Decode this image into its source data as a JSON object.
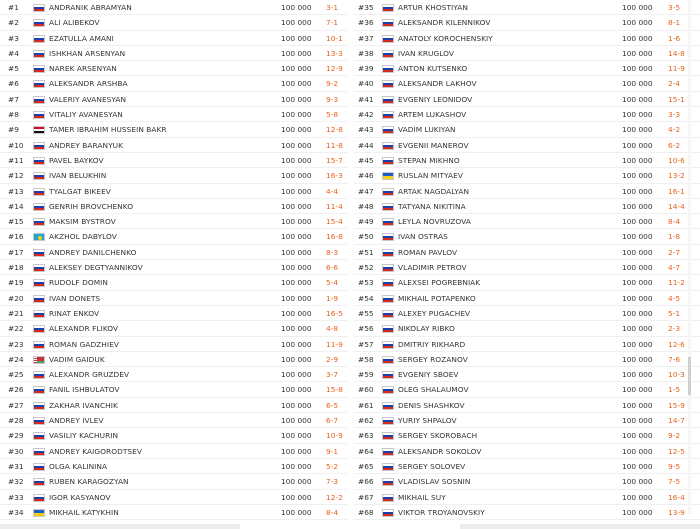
{
  "left_column": [
    {
      "rank": "#1",
      "flag": "ru",
      "name": "Andranik Abramyan",
      "rating": "100 000",
      "score": "3-1"
    },
    {
      "rank": "#2",
      "flag": "ru",
      "name": "Ali Alibekov",
      "rating": "100 000",
      "score": "7-1"
    },
    {
      "rank": "#3",
      "flag": "ru",
      "name": "Ezatulla Amani",
      "rating": "100 000",
      "score": "10-1"
    },
    {
      "rank": "#4",
      "flag": "ru",
      "name": "Ishkhan Arsenyan",
      "rating": "100 000",
      "score": "13-3"
    },
    {
      "rank": "#5",
      "flag": "ru",
      "name": "Narek Arsenyan",
      "rating": "100 000",
      "score": "12-9"
    },
    {
      "rank": "#6",
      "flag": "ru",
      "name": "Aleksandr Arshba",
      "rating": "100 000",
      "score": "9-2"
    },
    {
      "rank": "#7",
      "flag": "ru",
      "name": "Valeriy Avanesyan",
      "rating": "100 000",
      "score": "9-3"
    },
    {
      "rank": "#8",
      "flag": "ru",
      "name": "Vitaliy Avanesyan",
      "rating": "100 000",
      "score": "5-8"
    },
    {
      "rank": "#9",
      "flag": "eg",
      "name": "Tamer Ibrahim Hussein Bakr",
      "rating": "100 000",
      "score": "12-8"
    },
    {
      "rank": "#10",
      "flag": "ru",
      "name": "Andrey Baranyuk",
      "rating": "100 000",
      "score": "11-8"
    },
    {
      "rank": "#11",
      "flag": "ru",
      "name": "Pavel Baykov",
      "rating": "100 000",
      "score": "15-7"
    },
    {
      "rank": "#12",
      "flag": "ru",
      "name": "Ivan Belukhin",
      "rating": "100 000",
      "score": "16-3"
    },
    {
      "rank": "#13",
      "flag": "ru",
      "name": "Tyalgat Bikeev",
      "rating": "100 000",
      "score": "4-4"
    },
    {
      "rank": "#14",
      "flag": "ru",
      "name": "Genrih Brovchenko",
      "rating": "100 000",
      "score": "11-4"
    },
    {
      "rank": "#15",
      "flag": "ru",
      "name": "Maksim Bystrov",
      "rating": "100 000",
      "score": "15-4"
    },
    {
      "rank": "#16",
      "flag": "kz",
      "name": "Akzhol Dabylov",
      "rating": "100 000",
      "score": "16-8"
    },
    {
      "rank": "#17",
      "flag": "ru",
      "name": "Andrey Danilchenko",
      "rating": "100 000",
      "score": "8-3"
    },
    {
      "rank": "#18",
      "flag": "ru",
      "name": "Aleksey Degtyannikov",
      "rating": "100 000",
      "score": "6-6"
    },
    {
      "rank": "#19",
      "flag": "ru",
      "name": "Rudolf Domin",
      "rating": "100 000",
      "score": "5-4"
    },
    {
      "rank": "#20",
      "flag": "ru",
      "name": "Ivan Donets",
      "rating": "100 000",
      "score": "1-9"
    },
    {
      "rank": "#21",
      "flag": "ru",
      "name": "Rinat Enkov",
      "rating": "100 000",
      "score": "16-5"
    },
    {
      "rank": "#22",
      "flag": "ru",
      "name": "Alexandr Flikov",
      "rating": "100 000",
      "score": "4-8"
    },
    {
      "rank": "#23",
      "flag": "ru",
      "name": "Roman Gadzhiev",
      "rating": "100 000",
      "score": "11-9"
    },
    {
      "rank": "#24",
      "flag": "by",
      "name": "Vadim Gaiduk",
      "rating": "100 000",
      "score": "2-9"
    },
    {
      "rank": "#25",
      "flag": "ru",
      "name": "Alexandr Gruzdev",
      "rating": "100 000",
      "score": "3-7"
    },
    {
      "rank": "#26",
      "flag": "ru",
      "name": "Fanil Ishbulatov",
      "rating": "100 000",
      "score": "15-8"
    },
    {
      "rank": "#27",
      "flag": "ru",
      "name": "Zakhar Ivanchik",
      "rating": "100 000",
      "score": "6-5"
    },
    {
      "rank": "#28",
      "flag": "ru",
      "name": "Andrey Ivlev",
      "rating": "100 000",
      "score": "6-7"
    },
    {
      "rank": "#29",
      "flag": "ru",
      "name": "Vasiliy Kachurin",
      "rating": "100 000",
      "score": "10-9"
    },
    {
      "rank": "#30",
      "flag": "ru",
      "name": "Andrey Kaigorodtsev",
      "rating": "100 000",
      "score": "9-1"
    },
    {
      "rank": "#31",
      "flag": "ru",
      "name": "Olga Kalinina",
      "rating": "100 000",
      "score": "5-2"
    },
    {
      "rank": "#32",
      "flag": "ru",
      "name": "Ruben Karagozyan",
      "rating": "100 000",
      "score": "7-3"
    },
    {
      "rank": "#33",
      "flag": "ru",
      "name": "Igor Kasyanov",
      "rating": "100 000",
      "score": "12-2"
    },
    {
      "rank": "#34",
      "flag": "ua",
      "name": "Mikhail Katykhin",
      "rating": "100 000",
      "score": "8-4"
    }
  ],
  "right_column": [
    {
      "rank": "#35",
      "flag": "ru",
      "name": "Artur Khostiyan",
      "rating": "100 000",
      "score": "3-5"
    },
    {
      "rank": "#36",
      "flag": "ru",
      "name": "Aleksandr Kilennikov",
      "rating": "100 000",
      "score": "8-1"
    },
    {
      "rank": "#37",
      "flag": "ru",
      "name": "Anatoly Korochenskiy",
      "rating": "100 000",
      "score": "1-6"
    },
    {
      "rank": "#38",
      "flag": "ru",
      "name": "Ivan Kruglov",
      "rating": "100 000",
      "score": "14-8"
    },
    {
      "rank": "#39",
      "flag": "ru",
      "name": "Anton Kutsenko",
      "rating": "100 000",
      "score": "11-9"
    },
    {
      "rank": "#40",
      "flag": "ru",
      "name": "Aleksandr Lakhov",
      "rating": "100 000",
      "score": "2-4"
    },
    {
      "rank": "#41",
      "flag": "ru",
      "name": "Evgeniy Leonidov",
      "rating": "100 000",
      "score": "15-1"
    },
    {
      "rank": "#42",
      "flag": "ru",
      "name": "Artem Lukashov",
      "rating": "100 000",
      "score": "3-3"
    },
    {
      "rank": "#43",
      "flag": "ru",
      "name": "Vadim Lukiyan",
      "rating": "100 000",
      "score": "4-2"
    },
    {
      "rank": "#44",
      "flag": "ru",
      "name": "Evgenii Manerov",
      "rating": "100 000",
      "score": "6-2"
    },
    {
      "rank": "#45",
      "flag": "ru",
      "name": "Stepan Mikhno",
      "rating": "100 000",
      "score": "10-6"
    },
    {
      "rank": "#46",
      "flag": "ua",
      "name": "Ruslan Mityaev",
      "rating": "100 000",
      "score": "13-2"
    },
    {
      "rank": "#47",
      "flag": "ru",
      "name": "Artak Nagdalyan",
      "rating": "100 000",
      "score": "16-1"
    },
    {
      "rank": "#48",
      "flag": "ru",
      "name": "Tatyana Nikitina",
      "rating": "100 000",
      "score": "14-4"
    },
    {
      "rank": "#49",
      "flag": "ru",
      "name": "Leyla Novruzova",
      "rating": "100 000",
      "score": "8-4"
    },
    {
      "rank": "#50",
      "flag": "ru",
      "name": "Ivan Ostras",
      "rating": "100 000",
      "score": "1-8"
    },
    {
      "rank": "#51",
      "flag": "ru",
      "name": "Roman Pavlov",
      "rating": "100 000",
      "score": "2-7"
    },
    {
      "rank": "#52",
      "flag": "ru",
      "name": "Vladimir Petrov",
      "rating": "100 000",
      "score": "4-7"
    },
    {
      "rank": "#53",
      "flag": "ru",
      "name": "Alexsei Pogrebniak",
      "rating": "100 000",
      "score": "11-2"
    },
    {
      "rank": "#54",
      "flag": "ru",
      "name": "Mikhail Potapenko",
      "rating": "100 000",
      "score": "4-5"
    },
    {
      "rank": "#55",
      "flag": "ru",
      "name": "Alexey Pugachev",
      "rating": "100 000",
      "score": "5-1"
    },
    {
      "rank": "#56",
      "flag": "ru",
      "name": "Nikolay Ribko",
      "rating": "100 000",
      "score": "2-3"
    },
    {
      "rank": "#57",
      "flag": "ru",
      "name": "Dmitriy Rikhard",
      "rating": "100 000",
      "score": "12-6"
    },
    {
      "rank": "#58",
      "flag": "ru",
      "name": "Sergey Rozanov",
      "rating": "100 000",
      "score": "7-6"
    },
    {
      "rank": "#59",
      "flag": "ru",
      "name": "Evgeniy Sboev",
      "rating": "100 000",
      "score": "10-3"
    },
    {
      "rank": "#60",
      "flag": "ru",
      "name": "Oleg Shalaumov",
      "rating": "100 000",
      "score": "1-5"
    },
    {
      "rank": "#61",
      "flag": "ru",
      "name": "Denis Shashkov",
      "rating": "100 000",
      "score": "15-9"
    },
    {
      "rank": "#62",
      "flag": "ru",
      "name": "Yuriy Shpalov",
      "rating": "100 000",
      "score": "14-7"
    },
    {
      "rank": "#63",
      "flag": "ru",
      "name": "Sergey Skorobach",
      "rating": "100 000",
      "score": "9-2"
    },
    {
      "rank": "#64",
      "flag": "ru",
      "name": "Aleksandr Sokolov",
      "rating": "100 000",
      "score": "12-5"
    },
    {
      "rank": "#65",
      "flag": "ru",
      "name": "Sergey Solovev",
      "rating": "100 000",
      "score": "9-5"
    },
    {
      "rank": "#66",
      "flag": "ru",
      "name": "Vladislav Sosnin",
      "rating": "100 000",
      "score": "7-5"
    },
    {
      "rank": "#67",
      "flag": "ru",
      "name": "Mikhail Suy",
      "rating": "100 000",
      "score": "16-4"
    },
    {
      "rank": "#68",
      "flag": "ru",
      "name": "Viktor Troyanovskiy",
      "rating": "100 000",
      "score": "13-9"
    }
  ],
  "colors": {
    "score": "#e8641c",
    "text": "#333333",
    "row_divider": "#f0f0f0"
  }
}
